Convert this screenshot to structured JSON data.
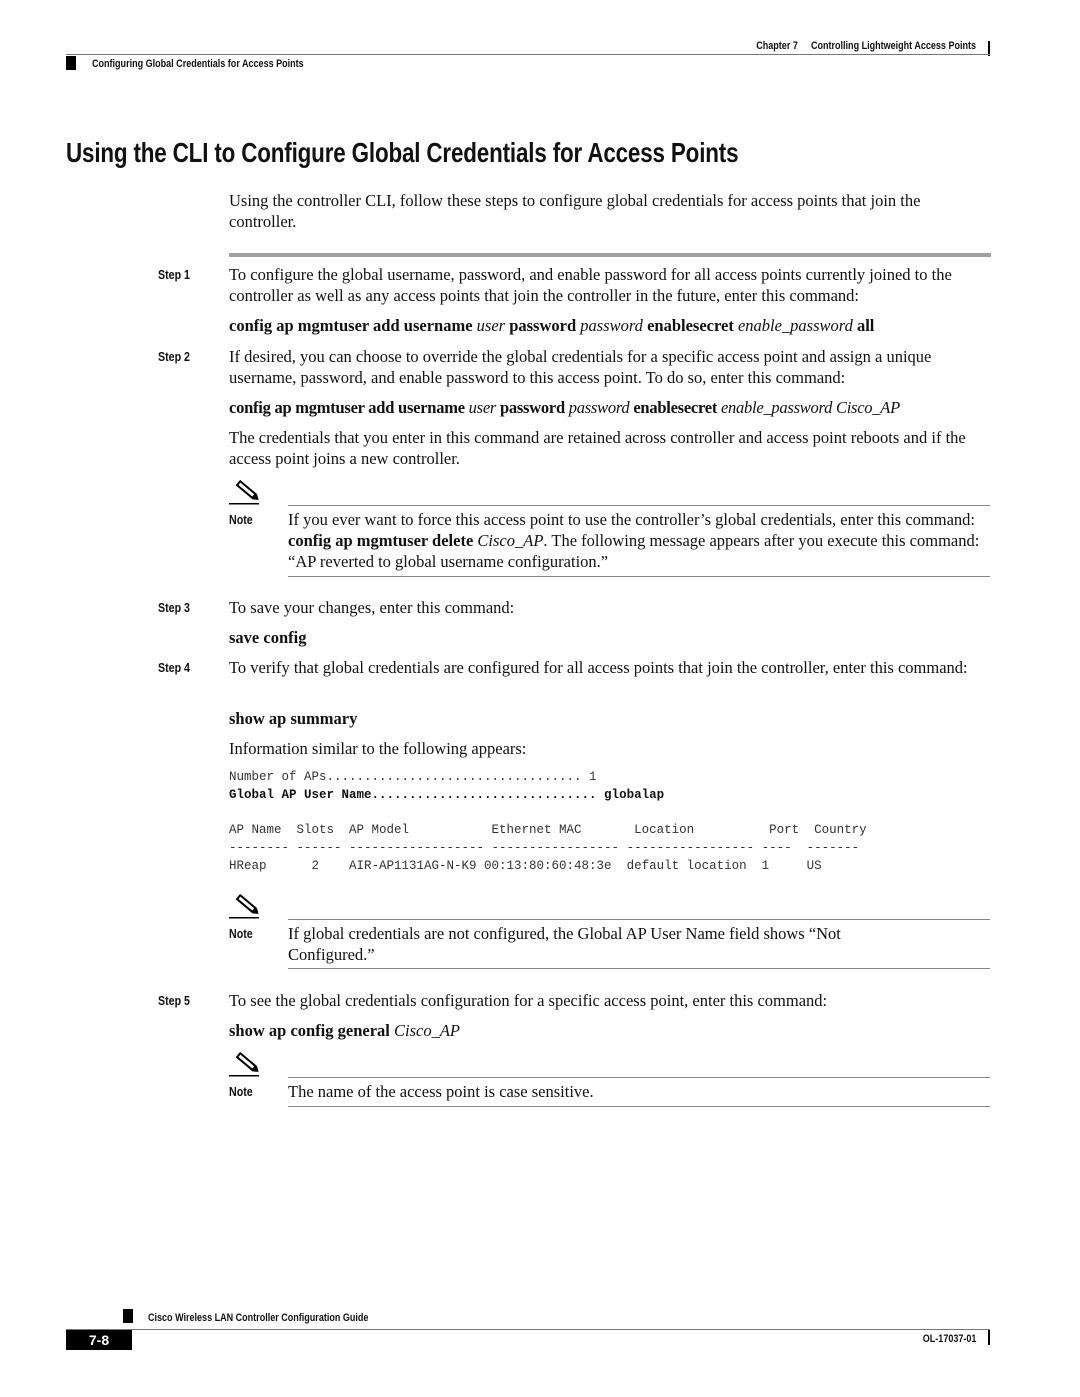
{
  "header": {
    "chapter": "Chapter 7",
    "chapter_title": "Controlling Lightweight Access Points",
    "section": "Configuring Global Credentials for Access Points"
  },
  "title": "Using the CLI to Configure Global Credentials for Access Points",
  "intro": "Using the controller CLI, follow these steps to configure global credentials for access points that join the controller.",
  "steps": [
    {
      "label": "Step 1",
      "text": "To configure the global username, password, and enable password for all access points currently joined to the controller as well as any access points that join the controller in the future, enter this command:",
      "command": {
        "p1": "config ap mgmtuser add username ",
        "a1": "user",
        "p2": " password ",
        "a2": "password",
        "p3": " enablesecret ",
        "a3": "enable_password",
        "p4": " all"
      }
    },
    {
      "label": "Step 2",
      "text": "If desired, you can choose to override the global credentials for a specific access point and assign a unique username, password, and enable password to this access point. To do so, enter this command:",
      "command": {
        "p1": "config ap mgmtuser add username ",
        "a1": "user",
        "p2": " password ",
        "a2": "password",
        "p3": " enablesecret ",
        "a3": "enable_password Cisco_AP"
      },
      "extra": "The credentials that you enter in this command are retained across controller and access point reboots and if the access point joins a new controller.",
      "note": {
        "label": "Note",
        "t1": "If you ever want to force this access point to use the controller’s global credentials, enter this command: ",
        "cmd": "config ap mgmtuser delete",
        "arg": "Cisco_AP",
        "t2": ". The following message appears after you execute this command: “AP reverted to global username configuration.”"
      }
    },
    {
      "label": "Step 3",
      "text": "To save your changes, enter this command:",
      "command": "save config"
    },
    {
      "label": "Step 4",
      "text": "To verify that global credentials are configured for all access points that join the controller, enter this command:",
      "command": "show ap summary",
      "output_intro": "Information similar to the following appears:",
      "output": {
        "line1": "Number of APs.................................. 1",
        "line2": "Global AP User Name.............................. globalap",
        "table_header": "AP Name  Slots  AP Model           Ethernet MAC       Location          Port  Country",
        "table_dashes": "-------- ------ ------------------ ----------------- ----------------- ----  -------",
        "table_rows": [
          "HReap      2    AIR-AP1131AG-N-K9 00:13:80:60:48:3e  default location  1     US"
        ]
      },
      "note": {
        "label": "Note",
        "text": "If global credentials are not configured, the Global AP User Name field shows “Not Configured.”"
      }
    },
    {
      "label": "Step 5",
      "text": "To see the global credentials configuration for a specific access point, enter this command:",
      "command": {
        "p1": "show ap config general ",
        "a1": "Cisco_AP"
      },
      "note": {
        "label": "Note",
        "text": "The name of the access point is case sensitive."
      }
    }
  ],
  "footer": {
    "guide_title": "Cisco Wireless LAN Controller Configuration Guide",
    "page_number": "7-8",
    "doc_number": "OL-17037-01"
  }
}
